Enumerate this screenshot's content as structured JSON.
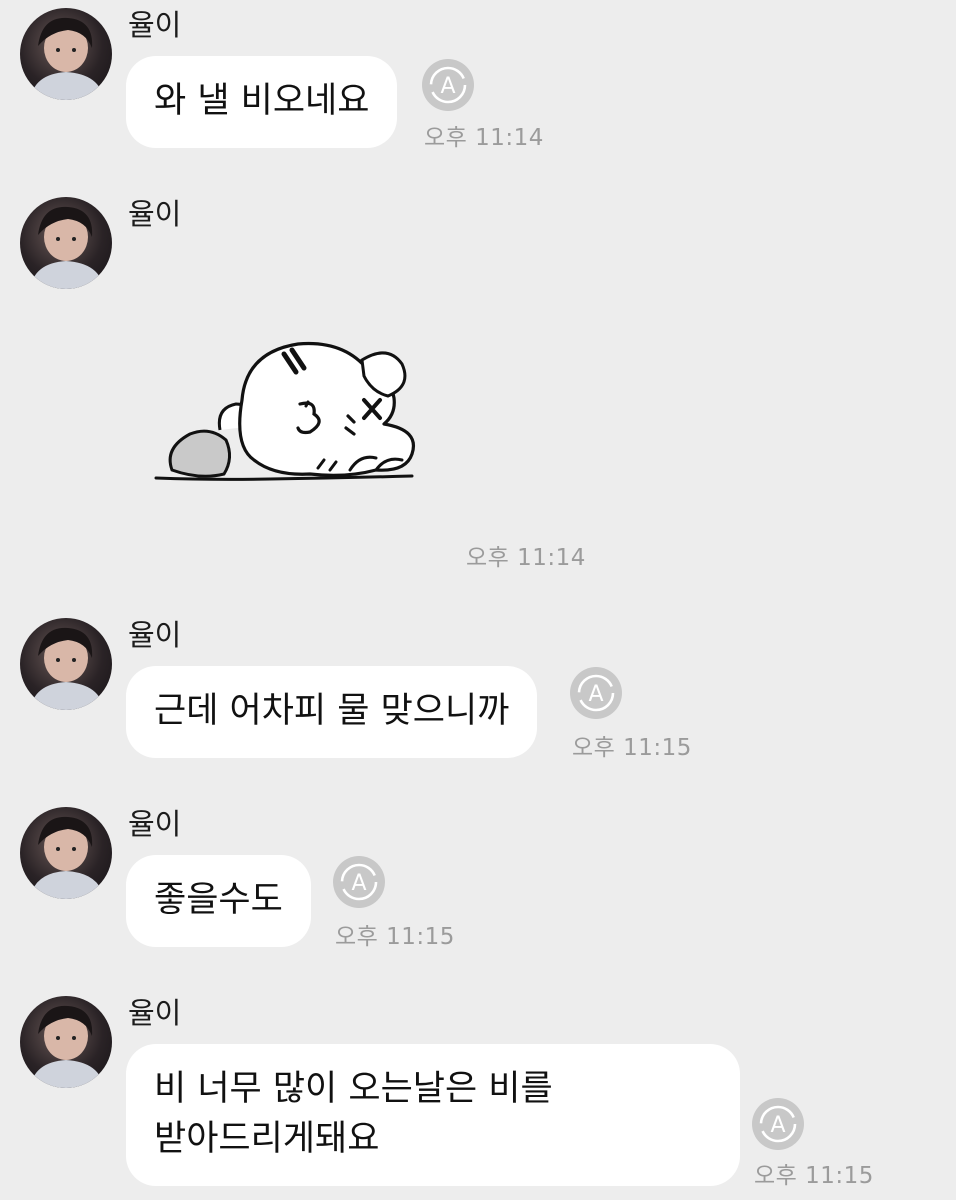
{
  "messages": [
    {
      "sender": "율이",
      "text": "와 낼 비오네요",
      "time": "오후 11:14"
    },
    {
      "sender": "율이",
      "sticker": "sleepy-puppy-sticker",
      "time": "오후 11:14"
    },
    {
      "sender": "율이",
      "text": "근데 어차피 물 맞으니까",
      "time": "오후 11:15"
    },
    {
      "sender": "율이",
      "text": "좋을수도",
      "time": "오후 11:15"
    },
    {
      "sender": "율이",
      "text": "비 너무 많이 오는날은 비를\n받아드리게돼요",
      "time": "오후 11:15"
    }
  ],
  "icons": {
    "translate": "translate-a-icon",
    "avatar": "profile-avatar"
  },
  "colors": {
    "background": "#ededed",
    "bubble": "#ffffff",
    "timestamp": "#9b9b9b",
    "translate_icon": "#c8c8c8"
  }
}
